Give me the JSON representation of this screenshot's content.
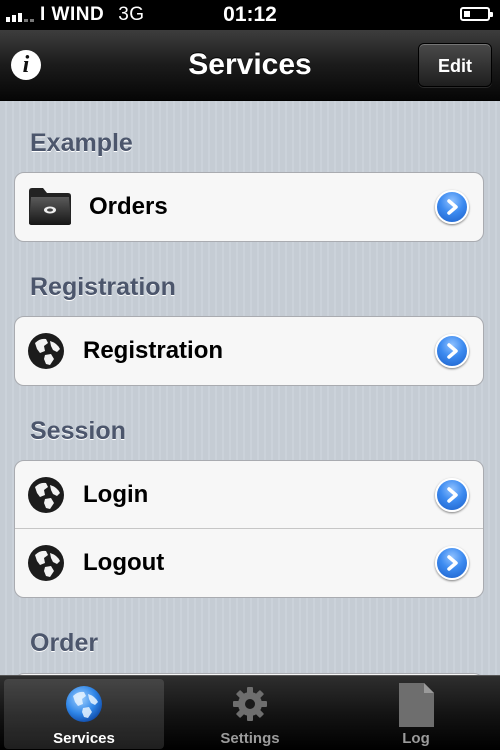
{
  "status_bar": {
    "carrier": "I WIND",
    "network": "3G",
    "time": "01:12",
    "signal_bars": 3,
    "battery_level": 0.25
  },
  "navbar": {
    "title": "Services",
    "edit_label": "Edit",
    "info_icon": "info-icon"
  },
  "sections": [
    {
      "header": "Example",
      "rows": [
        {
          "label": "Orders",
          "icon": "folder-icon"
        }
      ]
    },
    {
      "header": "Registration",
      "rows": [
        {
          "label": "Registration",
          "icon": "globe-icon"
        }
      ]
    },
    {
      "header": "Session",
      "rows": [
        {
          "label": "Login",
          "icon": "globe-icon"
        },
        {
          "label": "Logout",
          "icon": "globe-icon"
        }
      ]
    },
    {
      "header": "Order",
      "rows": []
    }
  ],
  "tabs": [
    {
      "label": "Services",
      "icon": "globe-icon",
      "active": true
    },
    {
      "label": "Settings",
      "icon": "gear-icon",
      "active": false
    },
    {
      "label": "Log",
      "icon": "document-icon",
      "active": false
    }
  ],
  "colors": {
    "accent_blue": "#2f7fe8",
    "section_header": "#4c566c",
    "background": "#c5ccd4"
  }
}
